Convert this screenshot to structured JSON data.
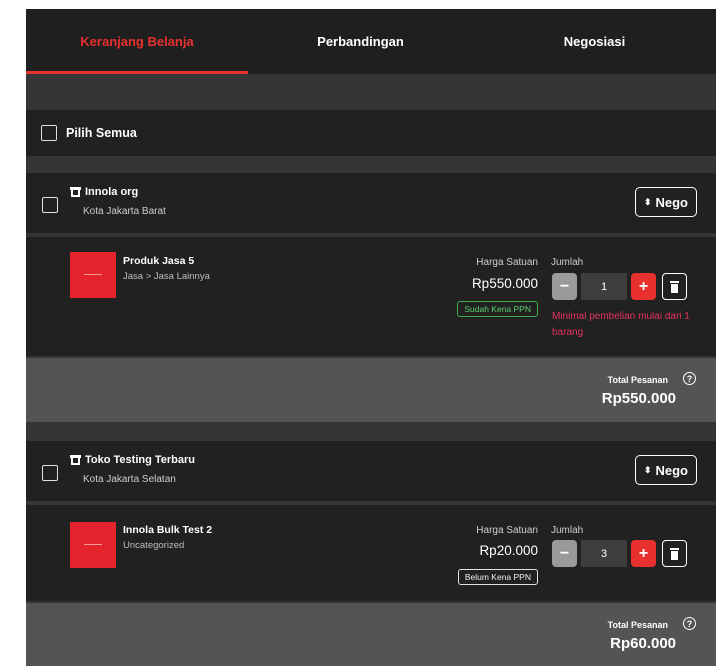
{
  "tabs": [
    {
      "label": "Keranjang Belanja",
      "active": true
    },
    {
      "label": "Perbandingan",
      "active": false
    },
    {
      "label": "Negosiasi",
      "active": false
    }
  ],
  "select_all": {
    "label": "Pilih Semua"
  },
  "common": {
    "nego_label": "Nego",
    "price_label": "Harga Satuan",
    "qty_label": "Jumlah",
    "total_label": "Total Pesanan"
  },
  "stores": [
    {
      "name": "Innola org",
      "city": "Kota Jakarta Barat",
      "product": {
        "name": "Produk Jasa 5",
        "category": "Jasa > Jasa Lainnya",
        "price": "Rp550.000",
        "ppn": "Sudah Kena PPN",
        "qty": "1",
        "min_message": "Minimal pembelian mulai dari 1 barang"
      },
      "total": "Rp550.000"
    },
    {
      "name": "Toko Testing Terbaru",
      "city": "Kota Jakarta Selatan",
      "product": {
        "name": "Innola Bulk Test 2",
        "category": "Uncategorized",
        "price": "Rp20.000",
        "ppn": "Belum Kena PPN",
        "qty": "3"
      },
      "total": "Rp60.000"
    }
  ],
  "colors": {
    "accent": "#e8312f",
    "panel": "#212121",
    "background": "#353535",
    "total_bar": "#545454",
    "ppn_green": "#3cae4c",
    "warning": "#e5335a"
  }
}
